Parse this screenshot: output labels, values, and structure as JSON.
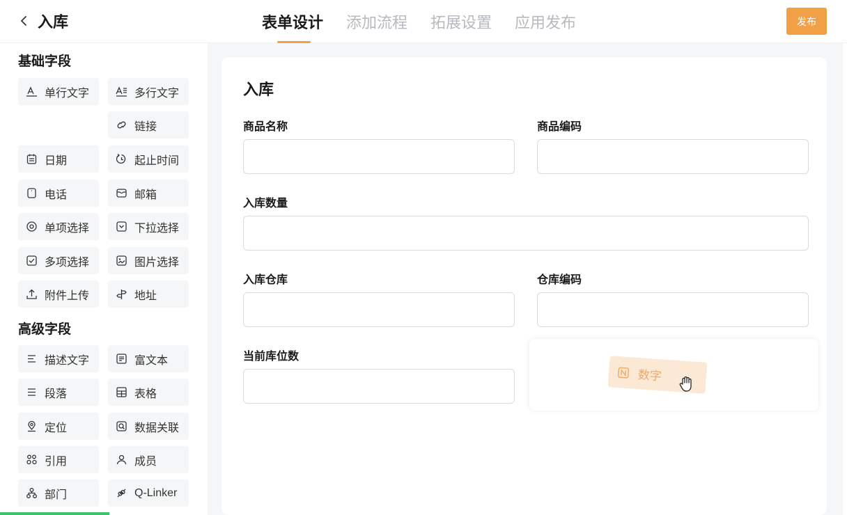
{
  "header": {
    "title": "入库",
    "tabs": [
      {
        "label": "表单设计",
        "active": true
      },
      {
        "label": "添加流程",
        "active": false
      },
      {
        "label": "拓展设置",
        "active": false
      },
      {
        "label": "应用发布",
        "active": false
      }
    ],
    "publish_label": "发布",
    "accent_color": "#f2a046"
  },
  "sidebar": {
    "basic_title": "基础字段",
    "basic_fields": [
      {
        "label": "单行文字",
        "icon": "text-line-icon"
      },
      {
        "label": "多行文字",
        "icon": "text-multiline-icon"
      },
      {
        "label": "链接",
        "icon": "link-icon"
      },
      {
        "label": "日期",
        "icon": "calendar-icon"
      },
      {
        "label": "起止时间",
        "icon": "time-range-icon"
      },
      {
        "label": "电话",
        "icon": "phone-icon"
      },
      {
        "label": "邮箱",
        "icon": "mail-icon"
      },
      {
        "label": "单项选择",
        "icon": "radio-icon"
      },
      {
        "label": "下拉选择",
        "icon": "dropdown-icon"
      },
      {
        "label": "多项选择",
        "icon": "checkbox-icon"
      },
      {
        "label": "图片选择",
        "icon": "image-icon"
      },
      {
        "label": "附件上传",
        "icon": "upload-icon"
      },
      {
        "label": "地址",
        "icon": "signpost-icon"
      }
    ],
    "advanced_title": "高级字段",
    "advanced_fields": [
      {
        "label": "描述文字",
        "icon": "description-icon"
      },
      {
        "label": "富文本",
        "icon": "richtext-icon"
      },
      {
        "label": "段落",
        "icon": "paragraph-icon"
      },
      {
        "label": "表格",
        "icon": "table-icon"
      },
      {
        "label": "定位",
        "icon": "location-icon"
      },
      {
        "label": "数据关联",
        "icon": "data-link-icon"
      },
      {
        "label": "引用",
        "icon": "reference-icon"
      },
      {
        "label": "成员",
        "icon": "member-icon"
      },
      {
        "label": "部门",
        "icon": "department-icon"
      },
      {
        "label": "Q-Linker",
        "icon": "qlinker-icon"
      }
    ]
  },
  "form": {
    "title": "入库",
    "fields": [
      {
        "label": "商品名称",
        "value": ""
      },
      {
        "label": "商品编码",
        "value": ""
      },
      {
        "label": "入库数量",
        "value": ""
      },
      {
        "label": "入库仓库",
        "value": ""
      },
      {
        "label": "仓库编码",
        "value": ""
      },
      {
        "label": "当前库位数",
        "value": ""
      }
    ],
    "dragging_item": {
      "label": "数字",
      "icon": "number-icon"
    }
  }
}
